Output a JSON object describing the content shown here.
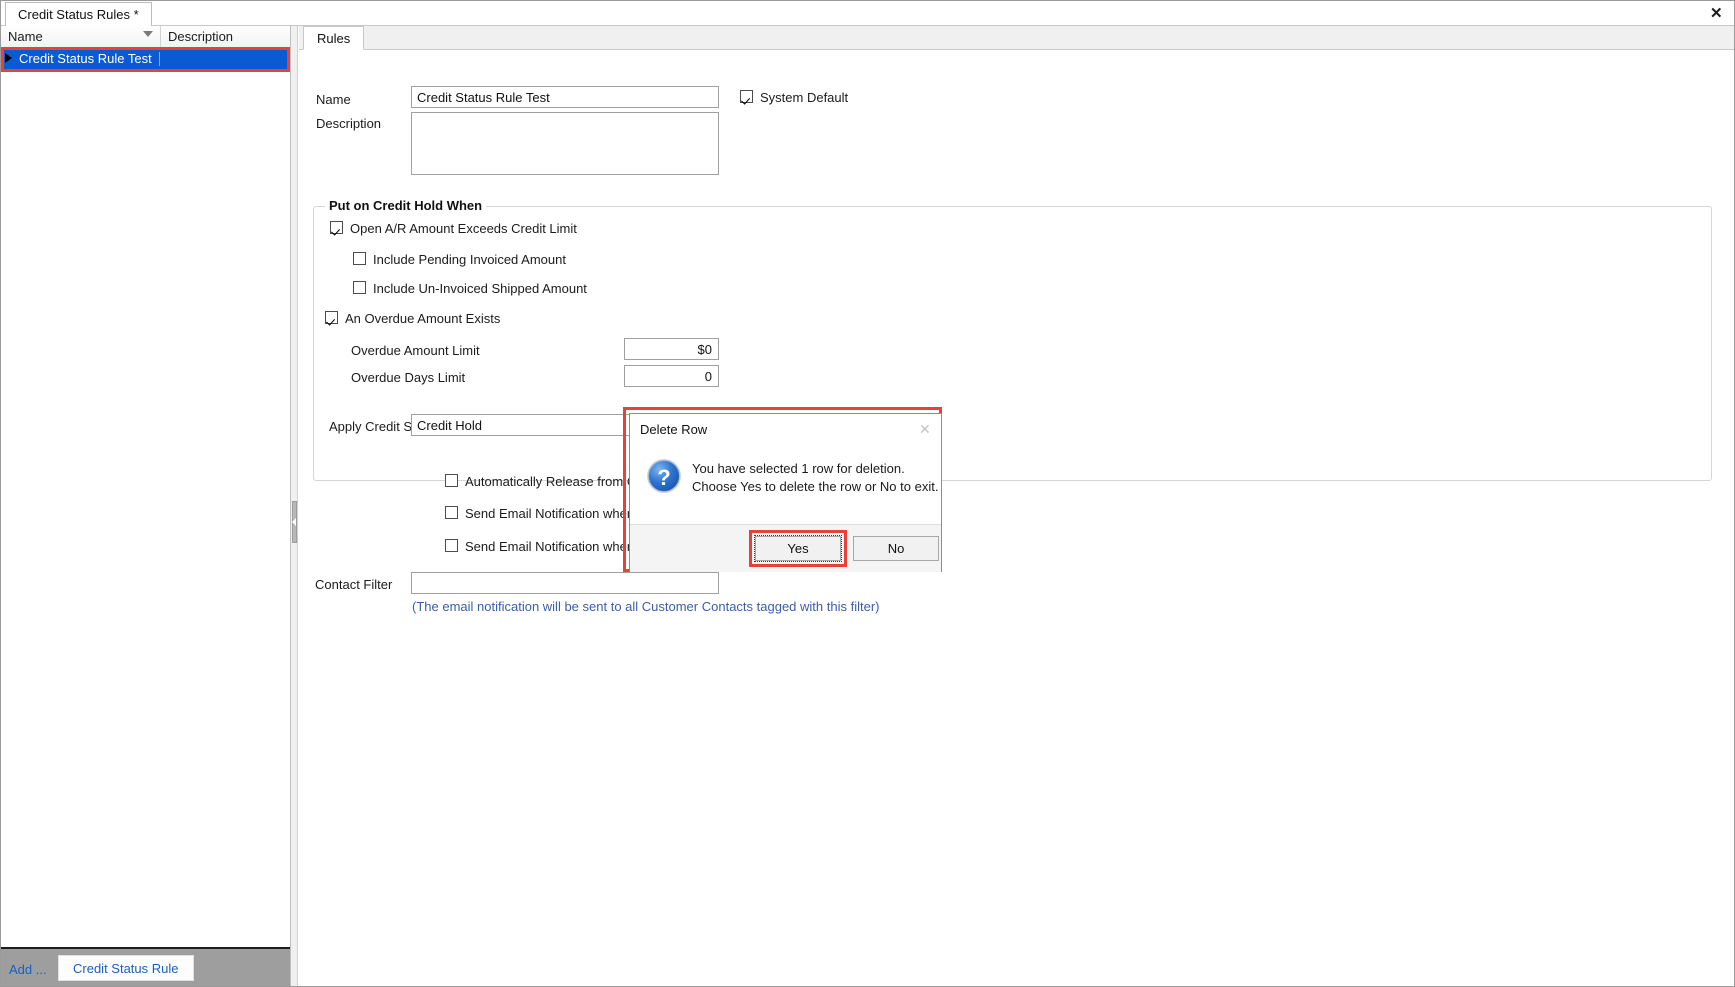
{
  "window": {
    "document_tab": "Credit Status Rules *",
    "close_label": "✕"
  },
  "left_panel": {
    "columns": [
      "Name",
      "Description"
    ],
    "rows": [
      {
        "name": "Credit Status Rule Test",
        "description": ""
      }
    ],
    "footer": {
      "add_label": "Add ...",
      "entity_button": "Credit Status Rule"
    }
  },
  "right_panel": {
    "tabs": [
      {
        "label": "Rules",
        "active": true
      }
    ],
    "form": {
      "name_label": "Name",
      "name_value": "Credit Status Rule Test",
      "description_label": "Description",
      "description_value": "",
      "system_default_label": "System Default",
      "system_default_checked": true,
      "group_title": "Put on Credit Hold When",
      "checks": [
        {
          "label": "Open A/R Amount Exceeds Credit Limit",
          "checked": true
        },
        {
          "label": "Include Pending Invoiced Amount",
          "checked": false
        },
        {
          "label": "Include Un-Invoiced Shipped Amount",
          "checked": false
        },
        {
          "label": "An Overdue Amount Exists",
          "checked": true
        }
      ],
      "overdue_amount_limit_label": "Overdue Amount Limit",
      "overdue_amount_limit_value": "$0",
      "overdue_days_limit_label": "Overdue Days Limit",
      "overdue_days_limit_value": "0",
      "apply_credit_status_label": "Apply Credit Status",
      "apply_credit_status_value": "Credit Hold",
      "lower_checks": [
        {
          "label": "Automatically Release from Cred",
          "checked": false
        },
        {
          "label": "Send Email Notification when Cu",
          "checked": false
        },
        {
          "label": "Send Email Notification when Cu",
          "checked": false
        }
      ],
      "contact_filter_label": "Contact Filter",
      "contact_filter_value": "",
      "contact_filter_hint": "(The email notification will be sent to all Customer Contacts tagged with this filter)"
    }
  },
  "dialog": {
    "title": "Delete Row",
    "close_label": "✕",
    "message_line1": "You have selected 1 row for deletion.",
    "message_line2": "Choose Yes to delete the row or No to exit.",
    "yes_label": "Yes",
    "no_label": "No",
    "icon": "question-icon"
  },
  "colors": {
    "selection_blue": "#0a5bd3",
    "annotation_red": "#e8413a",
    "link_blue": "#1a5fbf",
    "hint_blue": "#3b5ea8"
  }
}
